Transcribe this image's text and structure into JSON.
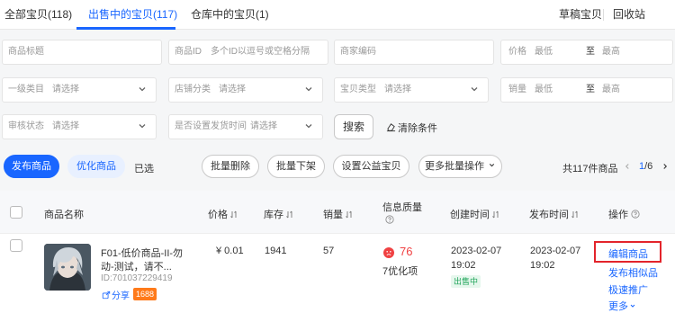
{
  "tabs": [
    {
      "label": "全部宝贝(118)"
    },
    {
      "label": "出售中的宝贝(117)"
    },
    {
      "label": "仓库中的宝贝(1)"
    }
  ],
  "top_right": {
    "drafts": "草稿宝贝",
    "recycle": "回收站"
  },
  "filters": {
    "title": "商品标题",
    "product_id_label": "商品ID",
    "product_id_placeholder": "多个ID以逗号或空格分隔",
    "merchant_code": "商家编码",
    "price_label": "价格",
    "price_min": "最低",
    "price_to": "至",
    "price_max": "最高",
    "category_label": "一级类目",
    "category_value": "请选择",
    "shop_category_label": "店铺分类",
    "shop_category_value": "请选择",
    "item_type_label": "宝贝类型",
    "item_type_value": "请选择",
    "sales_label": "销量",
    "sales_min": "最低",
    "sales_to": "至",
    "sales_max": "最高",
    "review_label": "审核状态",
    "review_value": "请选择",
    "ship_time_label": "是否设置发货时间",
    "ship_time_value": "请选择",
    "search_button": "搜索",
    "clear_button": "清除条件"
  },
  "actions": {
    "publish": "发布商品",
    "optimize": "优化商品",
    "selected": "已选",
    "batch_delete": "批量删除",
    "batch_offline": "批量下架",
    "set_charity": "设置公益宝贝",
    "more_batch": "更多批量操作",
    "total": "共117件商品",
    "page": "1",
    "pages": "/6"
  },
  "table": {
    "headers": {
      "name": "商品名称",
      "price": "价格",
      "stock": "库存",
      "sales": "销量",
      "quality": "信息质量",
      "created": "创建时间",
      "published": "发布时间",
      "operation": "操作"
    },
    "rows": [
      {
        "title_line1": "F01-低价商品-II-勿",
        "title_line2": "动-测试，请不...",
        "id": "ID:701037229419",
        "share": "分享",
        "source_tag": "1688",
        "price": "¥ 0.01",
        "stock": "1941",
        "sales": "57",
        "quality_score": "76",
        "quality_note": "7优化项",
        "created_date": "2023-02-07",
        "created_time": "19:02",
        "status": "出售中",
        "published_date": "2023-02-07",
        "published_time": "19:02",
        "ops": {
          "edit": "编辑商品",
          "similar": "发布相似品",
          "promote": "极速推广",
          "more": "更多"
        }
      }
    ]
  },
  "colors": {
    "accent": "#1966ff",
    "score_red": "#f04142",
    "status_green": "#21a55b",
    "tag_orange": "#ff7a1a",
    "highlight_border": "#e3242b"
  }
}
